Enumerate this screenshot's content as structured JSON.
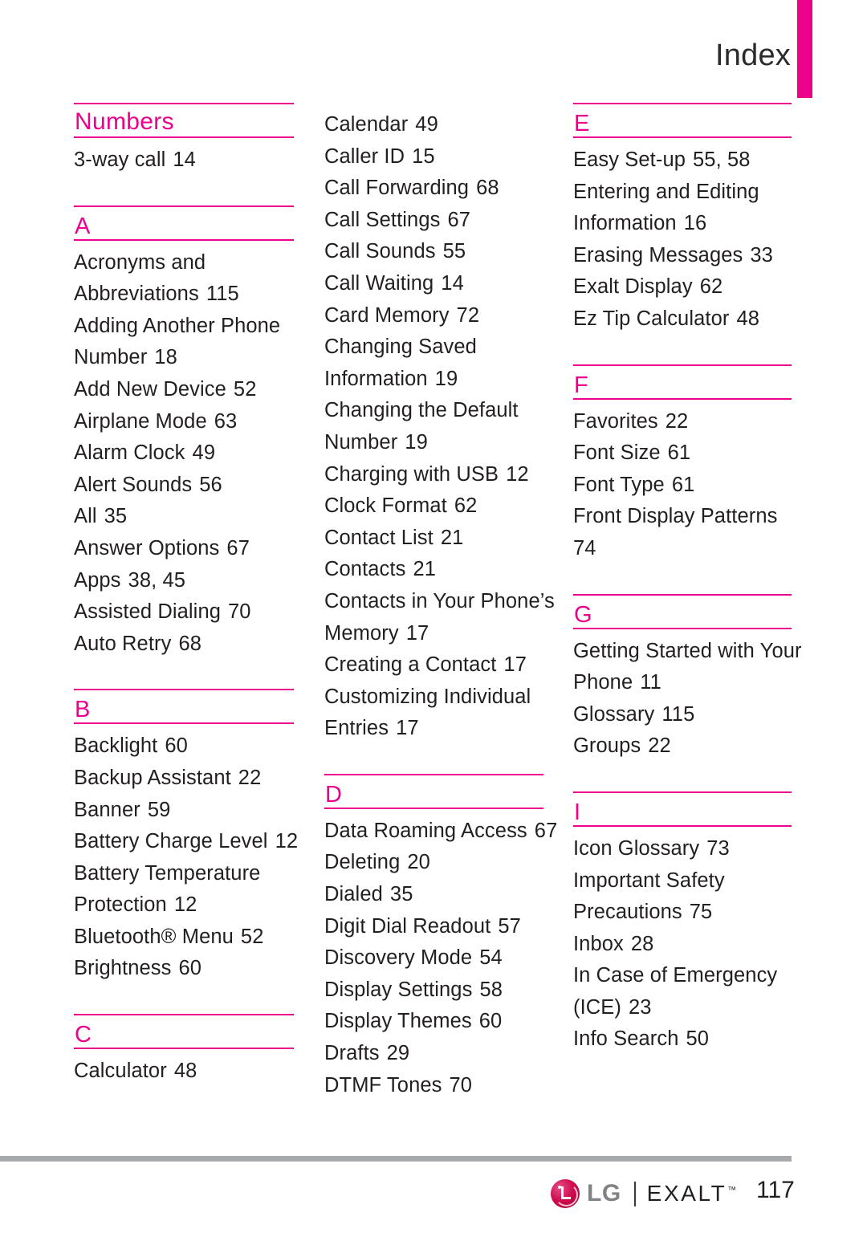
{
  "header": {
    "title": "Index",
    "accent_color": "#ec008c"
  },
  "colors": {
    "accent": "#ec008c",
    "text": "#231f20",
    "footer_rule": "#a7a9ac",
    "lg_wordmark": "#808285"
  },
  "columns": [
    {
      "id": "column-1",
      "sections": [
        {
          "heading": "Numbers",
          "heading_kind": "word",
          "entries": [
            {
              "title": "3-way call",
              "pages": "14"
            }
          ]
        },
        {
          "heading": "A",
          "heading_kind": "letter",
          "entries": [
            {
              "title": "Acronyms and",
              "pages": ""
            },
            {
              "title": "Abbreviations",
              "pages": "115"
            },
            {
              "title": "Adding Another Phone",
              "pages": ""
            },
            {
              "title": "Number",
              "pages": "18"
            },
            {
              "title": "Add New Device",
              "pages": "52"
            },
            {
              "title": "Airplane Mode",
              "pages": "63"
            },
            {
              "title": "Alarm Clock",
              "pages": "49"
            },
            {
              "title": "Alert Sounds",
              "pages": "56"
            },
            {
              "title": "All",
              "pages": "35"
            },
            {
              "title": "Answer Options",
              "pages": "67"
            },
            {
              "title": "Apps",
              "pages": "38, 45"
            },
            {
              "title": "Assisted Dialing",
              "pages": "70"
            },
            {
              "title": "Auto Retry",
              "pages": "68"
            }
          ]
        },
        {
          "heading": "B",
          "heading_kind": "letter",
          "entries": [
            {
              "title": "Backlight",
              "pages": "60"
            },
            {
              "title": "Backup Assistant",
              "pages": "22"
            },
            {
              "title": "Banner",
              "pages": "59"
            },
            {
              "title": "Battery Charge Level",
              "pages": "12"
            },
            {
              "title": "Battery Temperature",
              "pages": ""
            },
            {
              "title": "Protection",
              "pages": "12"
            },
            {
              "title": "Bluetooth® Menu",
              "pages": "52"
            },
            {
              "title": "Brightness",
              "pages": "60"
            }
          ]
        },
        {
          "heading": "C",
          "heading_kind": "letter",
          "entries": [
            {
              "title": "Calculator",
              "pages": "48"
            }
          ]
        }
      ]
    },
    {
      "id": "column-2",
      "sections": [
        {
          "heading": "",
          "heading_kind": "none",
          "entries": [
            {
              "title": "Calendar",
              "pages": "49"
            },
            {
              "title": "Caller ID",
              "pages": "15"
            },
            {
              "title": "Call Forwarding",
              "pages": "68"
            },
            {
              "title": "Call Settings",
              "pages": "67"
            },
            {
              "title": "Call Sounds",
              "pages": "55"
            },
            {
              "title": "Call Waiting",
              "pages": "14"
            },
            {
              "title": "Card Memory",
              "pages": "72"
            },
            {
              "title": "Changing Saved",
              "pages": ""
            },
            {
              "title": "Information",
              "pages": "19"
            },
            {
              "title": "Changing the Default",
              "pages": ""
            },
            {
              "title": "Number",
              "pages": "19"
            },
            {
              "title": "Charging with USB",
              "pages": "12"
            },
            {
              "title": "Clock Format",
              "pages": "62"
            },
            {
              "title": "Contact List",
              "pages": "21"
            },
            {
              "title": "Contacts",
              "pages": "21"
            },
            {
              "title": "Contacts in Your Phone’s",
              "pages": ""
            },
            {
              "title": "Memory",
              "pages": "17"
            },
            {
              "title": "Creating a Contact",
              "pages": "17"
            },
            {
              "title": "Customizing Individual",
              "pages": ""
            },
            {
              "title": "Entries",
              "pages": "17"
            }
          ]
        },
        {
          "heading": "D",
          "heading_kind": "letter",
          "entries": [
            {
              "title": "Data Roaming Access",
              "pages": "67"
            },
            {
              "title": "Deleting",
              "pages": "20"
            },
            {
              "title": "Dialed",
              "pages": "35"
            },
            {
              "title": "Digit Dial Readout",
              "pages": "57"
            },
            {
              "title": "Discovery Mode",
              "pages": "54"
            },
            {
              "title": "Display Settings",
              "pages": "58"
            },
            {
              "title": "Display Themes",
              "pages": "60"
            },
            {
              "title": "Drafts",
              "pages": "29"
            },
            {
              "title": "DTMF Tones",
              "pages": "70"
            }
          ]
        }
      ]
    },
    {
      "id": "column-3",
      "sections": [
        {
          "heading": "E",
          "heading_kind": "letter",
          "entries": [
            {
              "title": "Easy Set-up",
              "pages": "55, 58"
            },
            {
              "title": "Entering and Editing",
              "pages": ""
            },
            {
              "title": "Information",
              "pages": "16"
            },
            {
              "title": "Erasing Messages",
              "pages": "33"
            },
            {
              "title": "Exalt Display",
              "pages": "62"
            },
            {
              "title": "Ez Tip Calculator",
              "pages": "48"
            }
          ]
        },
        {
          "heading": "F",
          "heading_kind": "letter",
          "entries": [
            {
              "title": "Favorites",
              "pages": "22"
            },
            {
              "title": "Font Size",
              "pages": "61"
            },
            {
              "title": "Font Type",
              "pages": "61"
            },
            {
              "title": "Front Display Patterns",
              "pages": ""
            },
            {
              "title": "74",
              "pages": ""
            }
          ]
        },
        {
          "heading": "G",
          "heading_kind": "letter",
          "entries": [
            {
              "title": "Getting Started with Your",
              "pages": ""
            },
            {
              "title": "Phone",
              "pages": "11"
            },
            {
              "title": "Glossary",
              "pages": "115"
            },
            {
              "title": "Groups",
              "pages": "22"
            }
          ]
        },
        {
          "heading": "I",
          "heading_kind": "letter",
          "entries": [
            {
              "title": "Icon Glossary",
              "pages": "73"
            },
            {
              "title": "Important Safety",
              "pages": ""
            },
            {
              "title": "Precautions",
              "pages": "75"
            },
            {
              "title": "Inbox",
              "pages": "28"
            },
            {
              "title": "In Case of Emergency",
              "pages": ""
            },
            {
              "title": "(ICE)",
              "pages": "23"
            },
            {
              "title": "Info Search",
              "pages": "50"
            }
          ]
        }
      ]
    }
  ],
  "footer": {
    "lg_wordmark": "LG",
    "product_wordmark": "EXALT",
    "trademark": "™",
    "page_number": "117"
  }
}
